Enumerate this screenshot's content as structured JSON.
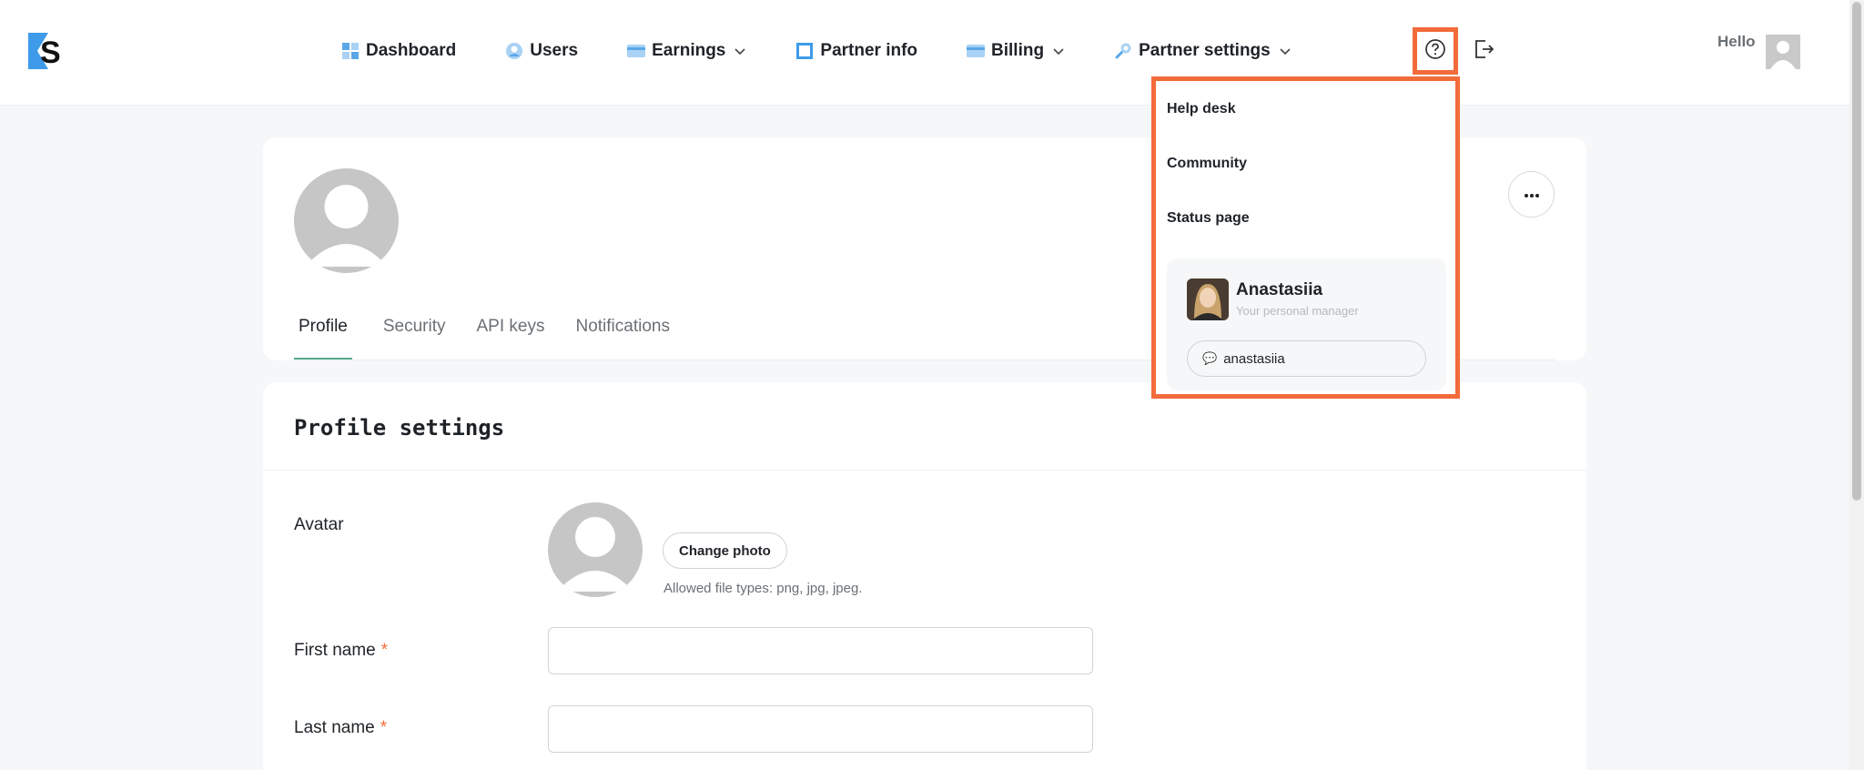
{
  "app": {
    "logo_icon": "zs-logo-icon"
  },
  "nav": {
    "items": [
      {
        "label": "Dashboard",
        "icon": "dashboard-grid-icon",
        "has_dropdown": false
      },
      {
        "label": "Users",
        "icon": "user-circle-icon",
        "has_dropdown": false
      },
      {
        "label": "Earnings",
        "icon": "card-icon",
        "has_dropdown": true
      },
      {
        "label": "Partner info",
        "icon": "square-info-icon",
        "has_dropdown": false
      },
      {
        "label": "Billing",
        "icon": "card-icon",
        "has_dropdown": true
      },
      {
        "label": "Partner settings",
        "icon": "wrench-icon",
        "has_dropdown": true
      }
    ]
  },
  "header": {
    "greeting": "Hello",
    "help_icon": "question-circle-icon",
    "logout_icon": "logout-icon"
  },
  "profile": {
    "tabs": [
      {
        "label": "Profile",
        "active": true
      },
      {
        "label": "Security",
        "active": false
      },
      {
        "label": "API keys",
        "active": false
      },
      {
        "label": "Notifications",
        "active": false
      }
    ]
  },
  "settings": {
    "title": "Profile settings",
    "avatar_label": "Avatar",
    "change_photo_label": "Change photo",
    "file_hint": "Allowed file types: png, jpg, jpeg.",
    "first_name_label": "First name",
    "last_name_label": "Last name",
    "required_mark": "*",
    "first_name_value": "",
    "last_name_value": ""
  },
  "help_menu": {
    "items": [
      "Help desk",
      "Community",
      "Status page"
    ],
    "manager": {
      "name": "Anastasiia",
      "role": "Your personal manager",
      "chat_handle": "anastasiia"
    }
  },
  "colors": {
    "accent_orange": "#f26b3a",
    "tab_active": "#59a98d",
    "logo_blue": "#3d9be9"
  }
}
